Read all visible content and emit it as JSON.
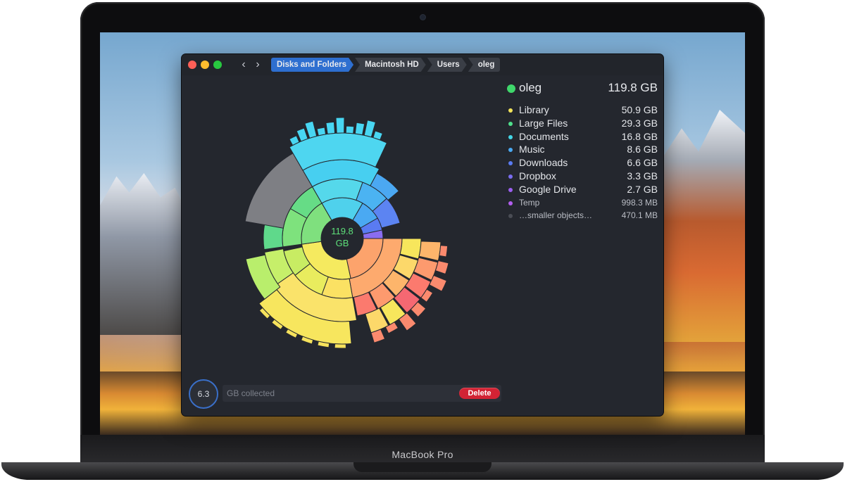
{
  "device": {
    "brand": "MacBook Pro"
  },
  "window": {
    "breadcrumbs": [
      "Disks and Folders",
      "Macintosh HD",
      "Users",
      "oleg"
    ]
  },
  "sunburst": {
    "center_line1": "119.8",
    "center_line2": "GB"
  },
  "summary": {
    "name": "oleg",
    "size": "119.8 GB",
    "color": "#3fd76b"
  },
  "legend": [
    {
      "name": "Library",
      "size": "50.9 GB",
      "color": "#f2e35a"
    },
    {
      "name": "Large Files",
      "size": "29.3 GB",
      "color": "#4fe08c"
    },
    {
      "name": "Documents",
      "size": "16.8 GB",
      "color": "#43d6e6"
    },
    {
      "name": "Music",
      "size": "8.6 GB",
      "color": "#4aa9f2"
    },
    {
      "name": "Downloads",
      "size": "6.6 GB",
      "color": "#5a7bf2"
    },
    {
      "name": "Dropbox",
      "size": "3.3 GB",
      "color": "#7a6df0"
    },
    {
      "name": "Google Drive",
      "size": "2.7 GB",
      "color": "#9b5ff0"
    },
    {
      "name": "Temp",
      "size": "998.3  MB",
      "color": "#b25ef0"
    },
    {
      "name": "…smaller objects…",
      "size": "470.1  MB",
      "color": "#4a4d55"
    }
  ],
  "collector": {
    "amount": "6.3",
    "label": "GB collected",
    "delete_label": "Delete"
  }
}
